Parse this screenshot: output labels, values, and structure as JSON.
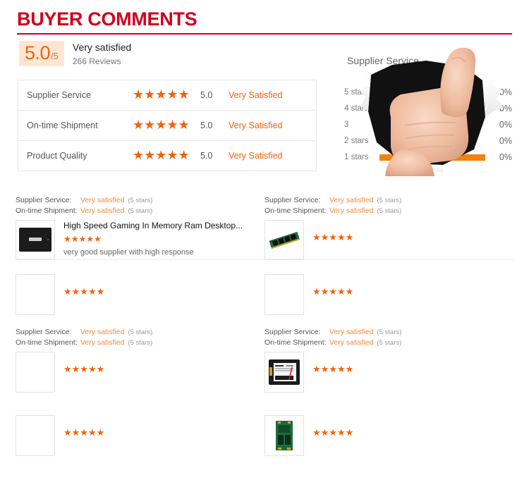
{
  "header": {
    "title": "BUYER COMMENTS",
    "accent_color": "#d0021b"
  },
  "overall": {
    "score": "5.0",
    "denominator": "/5",
    "label": "Very satisfied",
    "reviews_count": "266 Reviews",
    "score_bg": "#fde7d3",
    "score_color": "#f3620d"
  },
  "rating_table": {
    "rows": [
      {
        "name": "Supplier Service",
        "stars": "★★★★★",
        "score": "5.0",
        "word": "Very Satisfied"
      },
      {
        "name": "On-time Shipment",
        "stars": "★★★★★",
        "score": "5.0",
        "word": "Very Satisfied"
      },
      {
        "name": "Product Quality",
        "stars": "★★★★★",
        "score": "5.0",
        "word": "Very Satisfied"
      }
    ]
  },
  "chart_data": {
    "type": "bar",
    "title": "Supplier Service",
    "orientation": "horizontal",
    "categories": [
      "5 stars",
      "4 stars",
      "3",
      "2 stars",
      "1 stars"
    ],
    "values": [
      100,
      0,
      0,
      0,
      0
    ],
    "value_labels": [
      "100%",
      "0%",
      "0%",
      "0%",
      "0%"
    ],
    "xlabel": "",
    "ylabel": "",
    "xlim": [
      0,
      100
    ],
    "grid": false,
    "legend": "none",
    "bar_color": "#f3810d",
    "annotation": "thumbs-up photo overlays the bars"
  },
  "reviews": {
    "meta_keys": {
      "supplier_service": "Supplier Service:",
      "on_time_shipment": "On-time Shipment:"
    },
    "rows": [
      {
        "left": {
          "meta": [
            {
              "key": "Supplier Service:",
              "value": "Very satisfied",
              "stars_note": "(5 stars)"
            },
            {
              "key": "On-time Shipment:",
              "value": "Very satisfied",
              "stars_note": "(5 stars)"
            }
          ],
          "thumb": "black-ssd-drive",
          "product": "High Speed Gaming In Memory Ram Desktop...",
          "stars": "★★★★★",
          "comment": "very good supplier with high response"
        },
        "right": {
          "meta": [
            {
              "key": "Supplier Service:",
              "value": "Very satisfied",
              "stars_note": "(5 stars)"
            },
            {
              "key": "On-time Shipment:",
              "value": "Very satisfied",
              "stars_note": "(5 stars)"
            }
          ],
          "thumb": "green-memory-module",
          "product": "",
          "stars": "★★★★★",
          "comment": ""
        }
      },
      {
        "left": {
          "meta": [],
          "thumb": "blank",
          "product": "",
          "stars": "★★★★★",
          "comment": ""
        },
        "right": {
          "meta": [],
          "thumb": "blank",
          "product": "",
          "stars": "★★★★★",
          "comment": ""
        }
      },
      {
        "left": {
          "meta": [
            {
              "key": "Supplier Service:",
              "value": "Very satisfied",
              "stars_note": "(5 stars)"
            },
            {
              "key": "On-time Shipment:",
              "value": "Very satisfied",
              "stars_note": "(5 stars)"
            }
          ],
          "thumb": "blank",
          "product": "",
          "stars": "★★★★★",
          "comment": ""
        },
        "right": {
          "meta": [
            {
              "key": "Supplier Service:",
              "value": "Very satisfied",
              "stars_note": "(5 stars)"
            },
            {
              "key": "On-time Shipment:",
              "value": "Very satisfied",
              "stars_note": "(5 stars)"
            }
          ],
          "thumb": "labeled-ssd-drive",
          "product": "",
          "stars": "★★★★★",
          "comment": ""
        }
      },
      {
        "left": {
          "meta": [],
          "thumb": "blank",
          "product": "",
          "stars": "★★★★★",
          "comment": ""
        },
        "right": {
          "meta": [],
          "thumb": "green-msata-card",
          "product": "",
          "stars": "★★★★★",
          "comment": ""
        }
      }
    ]
  }
}
